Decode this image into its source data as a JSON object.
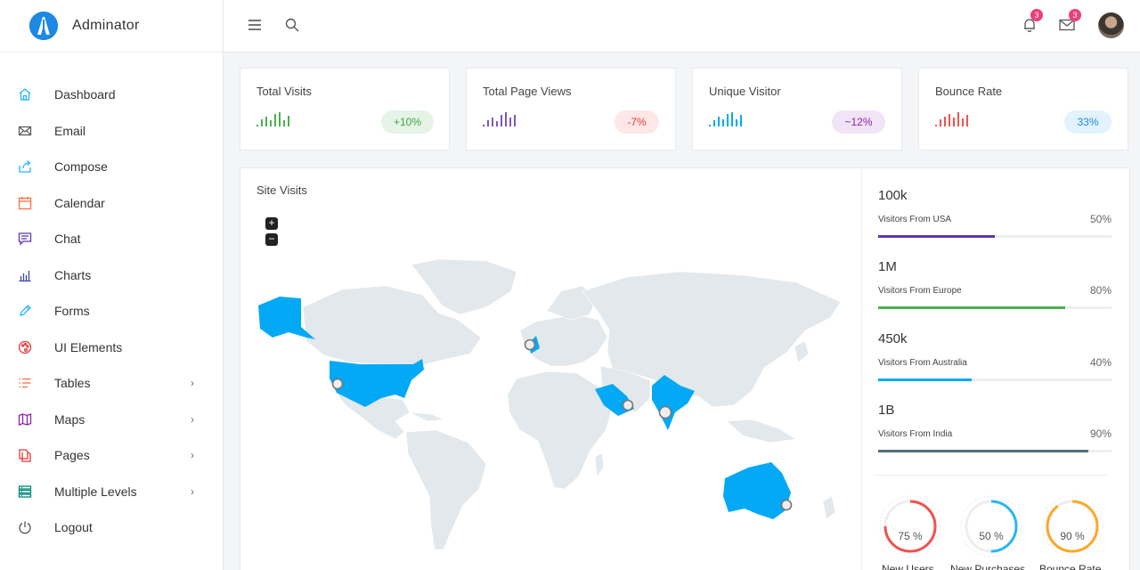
{
  "brand": {
    "name": "Adminator",
    "accent": "#1e88e5"
  },
  "sidebar": {
    "items": [
      {
        "label": "Dashboard",
        "icon": "home-icon",
        "color": "#29b6f6",
        "has_children": false
      },
      {
        "label": "Email",
        "icon": "mail-icon",
        "color": "#555555",
        "has_children": false
      },
      {
        "label": "Compose",
        "icon": "share-icon",
        "color": "#29b6f6",
        "has_children": false
      },
      {
        "label": "Calendar",
        "icon": "calendar-icon",
        "color": "#ff7043",
        "has_children": false
      },
      {
        "label": "Chat",
        "icon": "chat-icon",
        "color": "#5e35b1",
        "has_children": false
      },
      {
        "label": "Charts",
        "icon": "bar-chart-icon",
        "color": "#3949ab",
        "has_children": false
      },
      {
        "label": "Forms",
        "icon": "pencil-icon",
        "color": "#29b6f6",
        "has_children": false
      },
      {
        "label": "UI Elements",
        "icon": "palette-icon",
        "color": "#e53935",
        "has_children": false
      },
      {
        "label": "Tables",
        "icon": "list-icon",
        "color": "#ff7043",
        "has_children": true
      },
      {
        "label": "Maps",
        "icon": "map-icon",
        "color": "#8e24aa",
        "has_children": true
      },
      {
        "label": "Pages",
        "icon": "files-icon",
        "color": "#e53935",
        "has_children": true
      },
      {
        "label": "Multiple Levels",
        "icon": "layers-icon",
        "color": "#00897b",
        "has_children": true
      },
      {
        "label": "Logout",
        "icon": "power-icon",
        "color": "#555555",
        "has_children": false
      }
    ]
  },
  "topbar": {
    "notifications_count": "3",
    "messages_count": "3"
  },
  "stats": [
    {
      "title": "Total Visits",
      "badge": "+10%",
      "color": "#4caf50",
      "badge_bg": "#e5f4e6",
      "badge_color": "#43a047"
    },
    {
      "title": "Total Page Views",
      "badge": "-7%",
      "color": "#7e57c2",
      "badge_bg": "#fde7e7",
      "badge_color": "#e53935"
    },
    {
      "title": "Unique Visitor",
      "badge": "~12%",
      "color": "#03a9f4",
      "badge_bg": "#f1e4f6",
      "badge_color": "#8e24aa"
    },
    {
      "title": "Bounce Rate",
      "badge": "33%",
      "color": "#ef5350",
      "badge_bg": "#e2f3fd",
      "badge_color": "#1e88e5"
    }
  ],
  "site_visits": {
    "title": "Site Visits",
    "zoom_in": "+",
    "zoom_out": "−",
    "highlight_color": "#03a9f4",
    "land_color": "#e3e8ec"
  },
  "visitors": [
    {
      "value": "100k",
      "label": "Visitors From USA",
      "percent": "50%",
      "fraction": 0.5,
      "color": "#5e35b1"
    },
    {
      "value": "1M",
      "label": "Visitors From Europe",
      "percent": "80%",
      "fraction": 0.8,
      "color": "#4caf50"
    },
    {
      "value": "450k",
      "label": "Visitors From Australia",
      "percent": "40%",
      "fraction": 0.4,
      "color": "#03a9f4"
    },
    {
      "value": "1B",
      "label": "Visitors From India",
      "percent": "90%",
      "fraction": 0.9,
      "color": "#546e7a"
    }
  ],
  "donuts": [
    {
      "label": "75 %",
      "fraction": 0.75,
      "caption": "New Users",
      "color": "#ef5350"
    },
    {
      "label": "50 %",
      "fraction": 0.5,
      "caption": "New Purchases",
      "color": "#29b6f6"
    },
    {
      "label": "90 %",
      "fraction": 0.9,
      "caption": "Bounce Rate",
      "color": "#ffa726"
    }
  ]
}
